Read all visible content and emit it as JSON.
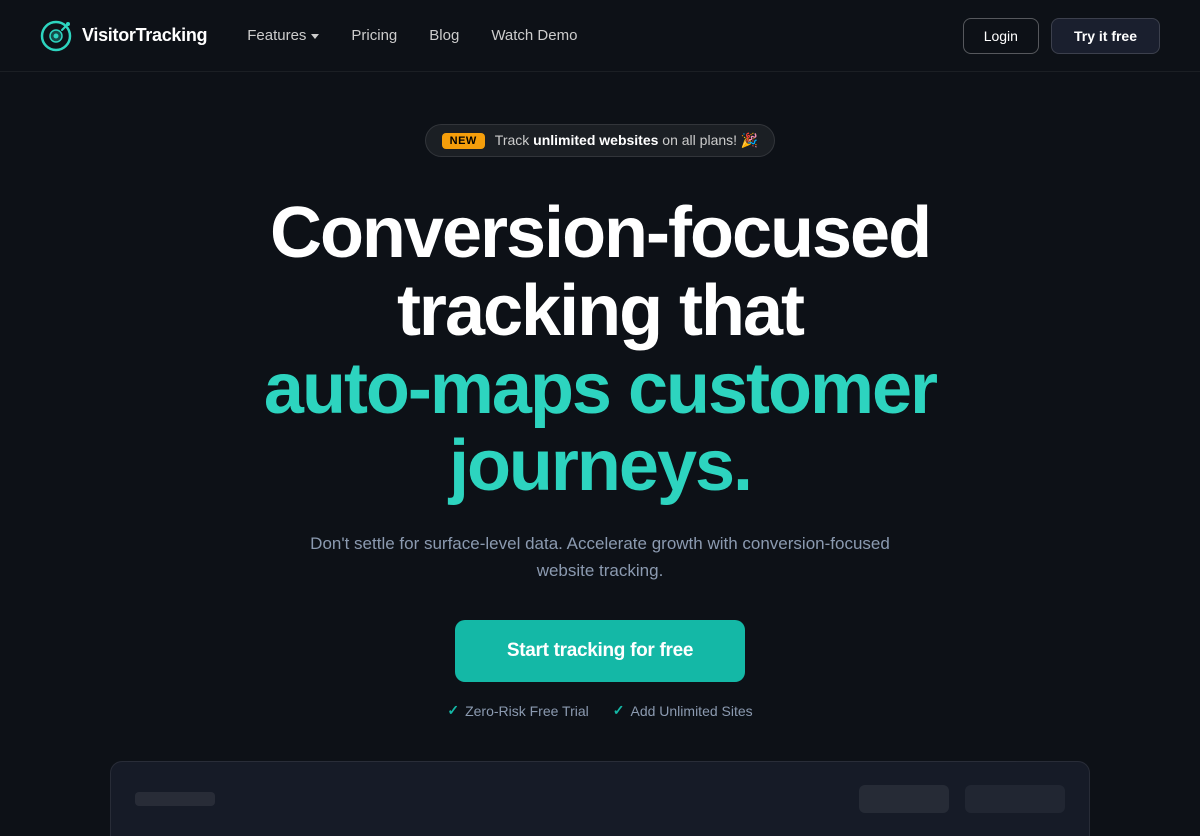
{
  "brand": {
    "name": "VisitorTracking"
  },
  "nav": {
    "features_label": "Features",
    "pricing_label": "Pricing",
    "blog_label": "Blog",
    "watchdemo_label": "Watch Demo",
    "login_label": "Login",
    "try_label": "Try it free"
  },
  "announcement": {
    "badge": "NEW",
    "text_before": "Track ",
    "text_bold": "unlimited websites",
    "text_after": " on all plans! 🎉"
  },
  "hero": {
    "headline_white": "Conversion-focused tracking that",
    "headline_teal": "auto-maps customer journeys.",
    "subtext": "Don't settle for surface-level data. Accelerate growth with conversion-focused website tracking.",
    "cta_label": "Start tracking for free",
    "check1": "Zero-Risk Free Trial",
    "check2": "Add Unlimited Sites"
  }
}
